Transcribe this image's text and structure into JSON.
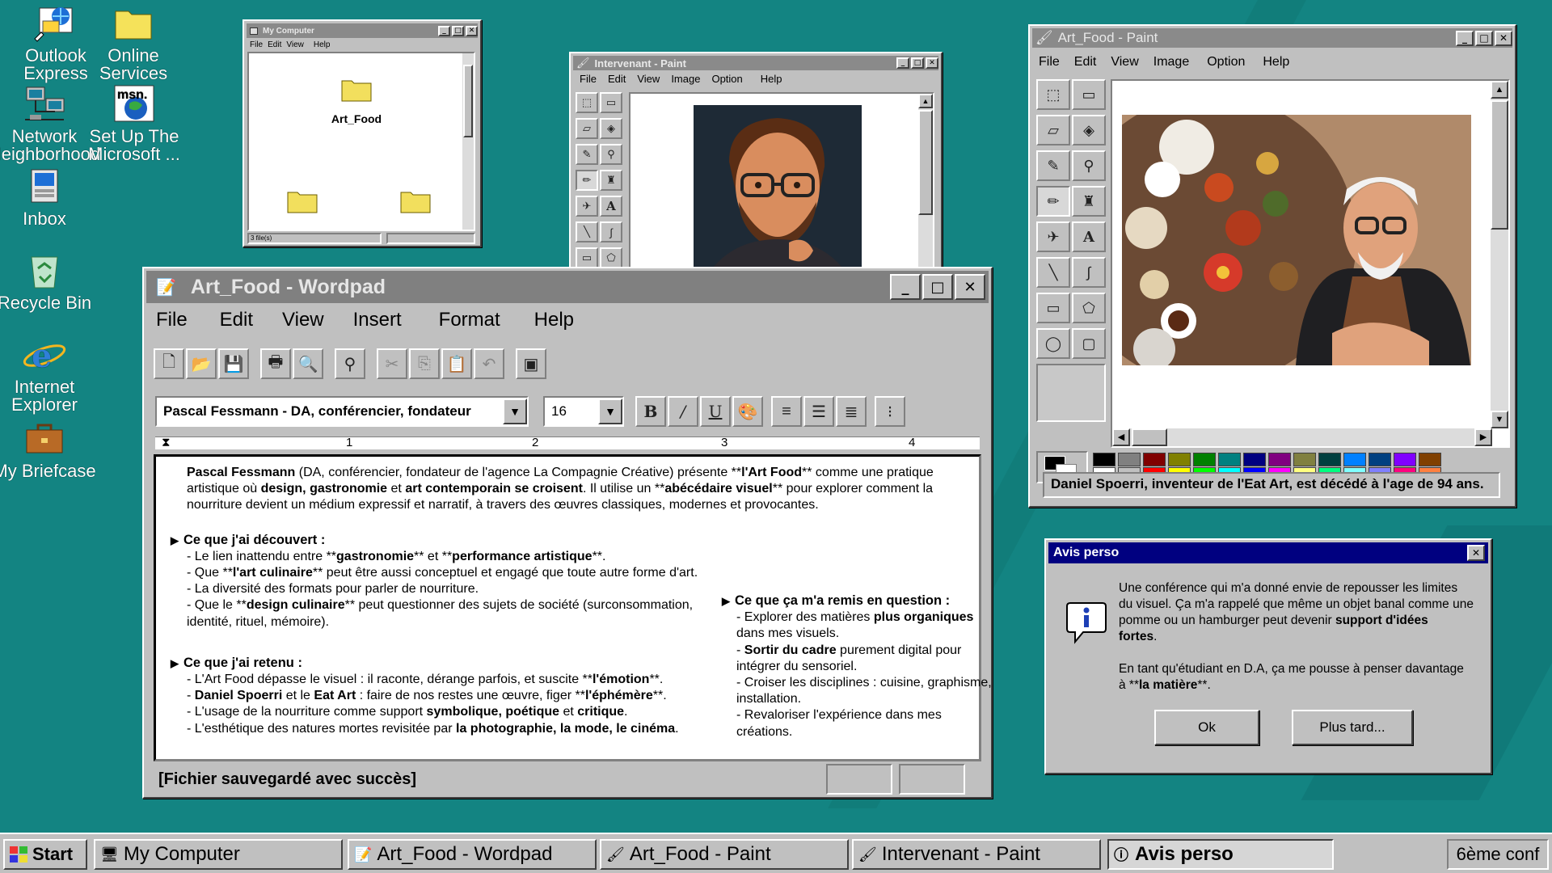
{
  "desktop": {
    "icons": [
      {
        "label_1": "Outlook",
        "label_2": "Express"
      },
      {
        "label_1": "Online",
        "label_2": "Services"
      },
      {
        "label_1": "Network",
        "label_2": "Neighborhood"
      },
      {
        "label_1": "Set Up The",
        "label_2": "Microsoft ..."
      },
      {
        "label_1": "Inbox",
        "label_2": ""
      },
      {
        "label_1": "Recycle Bin",
        "label_2": ""
      },
      {
        "label_1": "Internet",
        "label_2": "Explorer"
      },
      {
        "label_1": "My Briefcase",
        "label_2": ""
      }
    ],
    "msn_text": "msn."
  },
  "my_computer": {
    "title": "My Computer",
    "menu": [
      "File",
      "Edit",
      "View",
      "Help"
    ],
    "folder_label": "Art_Food",
    "status": "3 file(s)"
  },
  "intervenant_paint": {
    "title": "Intervenant - Paint",
    "menu": [
      "File",
      "Edit",
      "View",
      "Image",
      "Option",
      "Help"
    ]
  },
  "artfood_paint": {
    "title": "Art_Food - Paint",
    "menu": [
      "File",
      "Edit",
      "View",
      "Image",
      "Option",
      "Help"
    ],
    "status": "Daniel Spoerri, inventeur de l'Eat Art, est décédé à l'age de 94 ans.",
    "palette_top": [
      "#000000",
      "#808080",
      "#800000",
      "#808000",
      "#008000",
      "#008080",
      "#000080",
      "#800080",
      "#808040",
      "#004040",
      "#0080ff",
      "#004080",
      "#8000ff",
      "#804000"
    ],
    "palette_bottom": [
      "#ffffff",
      "#c0c0c0",
      "#ff0000",
      "#ffff00",
      "#00ff00",
      "#00ffff",
      "#0000ff",
      "#ff00ff",
      "#ffff80",
      "#00ff80",
      "#80ffff",
      "#8080ff",
      "#ff0080",
      "#ff8040"
    ]
  },
  "wordpad": {
    "title": "Art_Food - Wordpad",
    "menu": [
      "File",
      "Edit",
      "View",
      "Insert",
      "Format",
      "Help"
    ],
    "font_name": "Pascal Fessmann - DA, conférencier, fondateur",
    "font_size": "16",
    "ruler_numbers": [
      "1",
      "2",
      "3",
      "4"
    ],
    "status": "[Fichier sauvegardé avec succès]",
    "intro": {
      "l1_b": "Pascal Fessmann",
      "l1_a": " (DA, conférencier, fondateur de l'agence La Compagnie Créative) présente **",
      "l1_b2": "l'Art Food",
      "l1_c": "** comme une pratique",
      "l2_a": "artistique où ",
      "l2_b": "design, gastronomie",
      "l2_c": " et ",
      "l2_d": "art contemporain se croisent",
      "l2_e": ". Il utilise un **",
      "l2_f": "abécédaire visuel",
      "l2_g": "** pour explorer comment la",
      "l3": "nourriture devient un médium expressif et narratif, à travers des œuvres classiques, modernes et provocantes."
    },
    "decouvert": {
      "heading": "Ce que j'ai découvert :",
      "i1_a": "- Le lien inattendu entre **",
      "i1_b": "gastronomie",
      "i1_c": "** et **",
      "i1_d": "performance artistique",
      "i1_e": "**.",
      "i2_a": "- Que **",
      "i2_b": "l'art culinaire",
      "i2_c": "** peut être aussi conceptuel et engagé que toute autre forme d'art.",
      "i3": "- La diversité des formats pour parler de nourriture.",
      "i4_a": "- Que le **",
      "i4_b": "design culinaire",
      "i4_c": "** peut questionner des sujets de société (surconsommation,",
      "i4_d": "identité, rituel, mémoire)."
    },
    "retenu": {
      "heading": "Ce que j'ai retenu :",
      "i1_a": "- L'Art Food dépasse le visuel : il raconte, dérange parfois, et suscite **",
      "i1_b": "l'émotion",
      "i1_c": "**.",
      "i2_a": "- ",
      "i2_b": "Daniel Spoerri",
      "i2_c": " et le ",
      "i2_d": "Eat Art",
      "i2_e": " : faire de nos restes une œuvre, figer **",
      "i2_f": "l'éphémère",
      "i2_g": "**.",
      "i3_a": "- L'usage de la nourriture comme support ",
      "i3_b": "symbolique, poétique",
      "i3_c": " et ",
      "i3_d": "critique",
      "i3_e": ".",
      "i4_a": "- L'esthétique des natures mortes revisitée par ",
      "i4_b": "la photographie, la mode, le cinéma",
      "i4_c": "."
    },
    "question": {
      "heading": "Ce que ça m'a remis en question :",
      "l1": "- Explorer des matières ",
      "l1_b": "plus organiques",
      "l2": "dans mes visuels.",
      "l3_a": "- ",
      "l3_b": "Sortir du cadre",
      "l3_c": " purement digital pour",
      "l4": "intégrer du sensoriel.",
      "l5": "- Croiser les disciplines : cuisine, graphisme,",
      "l6": "installation.",
      "l7": "- Revaloriser l'expérience dans mes",
      "l8": "créations."
    }
  },
  "dialog": {
    "title": "Avis perso",
    "p1_l1": "Une conférence qui m'a donné envie de repousser les limites",
    "p1_l2": "du visuel. Ça m'a rappelé que même un objet banal comme une",
    "p1_l3_a": "pomme ou un hamburger peut devenir ",
    "p1_l3_b": "support d'idées",
    "p1_l4": "fortes",
    "p1_l4_b": ".",
    "p2_l1": "En tant qu'étudiant en D.A, ça me pousse à penser davantage",
    "p2_l2_a": "à **",
    "p2_l2_b": "la matière",
    "p2_l2_c": "**.",
    "ok": "Ok",
    "later": "Plus tard..."
  },
  "taskbar": {
    "start": "Start",
    "items": [
      "My Computer",
      "Art_Food - Wordpad",
      "Art_Food - Paint",
      "Intervenant - Paint",
      "Avis perso"
    ],
    "tray": "6ème conf"
  }
}
